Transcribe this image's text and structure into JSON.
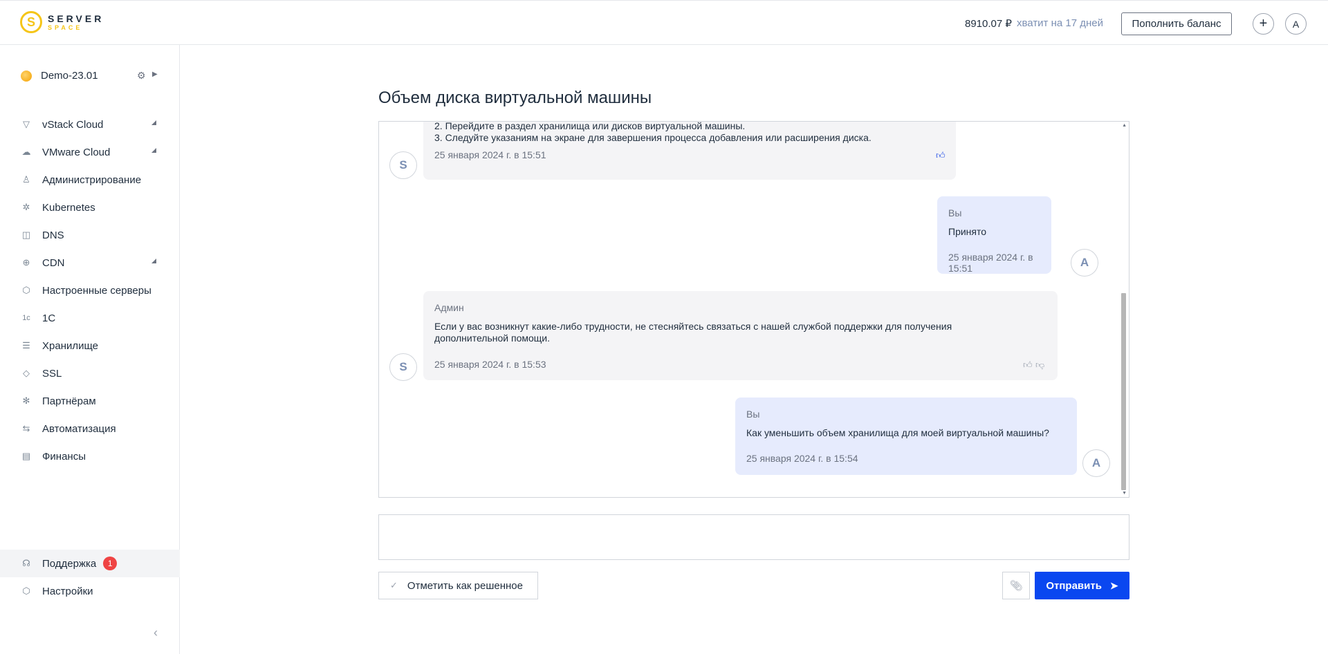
{
  "header": {
    "logo_top": "SERVER",
    "logo_bottom": "SPACE",
    "logo_mark": "S",
    "balance": "8910.07 ₽",
    "enough": "хватит на 17 дней",
    "topup_label": "Пополнить баланс",
    "plus_symbol": "+",
    "user_initial": "A"
  },
  "sidebar": {
    "project_name": "Demo-23.01",
    "items": [
      {
        "label": "vStack Cloud",
        "icon": "▽",
        "caret": true
      },
      {
        "label": "VMware Cloud",
        "icon": "☁",
        "caret": true
      },
      {
        "label": "Администрирование",
        "icon": "♙",
        "caret": false
      },
      {
        "label": "Kubernetes",
        "icon": "✲",
        "caret": false
      },
      {
        "label": "DNS",
        "icon": "◫",
        "caret": false
      },
      {
        "label": "CDN",
        "icon": "⊕",
        "caret": true
      },
      {
        "label": "Настроенные серверы",
        "icon": "⬡",
        "caret": false
      },
      {
        "label": "1С",
        "icon": "1c",
        "caret": false
      },
      {
        "label": "Хранилище",
        "icon": "☰",
        "caret": false
      },
      {
        "label": "SSL",
        "icon": "◇",
        "caret": false
      },
      {
        "label": "Партнёрам",
        "icon": "✻",
        "caret": false
      },
      {
        "label": "Автоматизация",
        "icon": "⇆",
        "caret": false
      },
      {
        "label": "Финансы",
        "icon": "▤",
        "caret": false
      }
    ],
    "support_label": "Поддержка",
    "support_badge": "1",
    "settings_label": "Настройки",
    "collapse_symbol": "‹"
  },
  "main": {
    "title": "Объем диска виртуальной машины",
    "messages": {
      "m1": {
        "line2": "2. Перейдите в раздел хранилища или дисков виртуальной машины.",
        "line3": "3. Следуйте указаниям на экране для завершения процесса добавления или расширения диска.",
        "time": "25 января 2024 г. в 15:51",
        "avatar": "S"
      },
      "m2": {
        "author": "Вы",
        "text": "Принято",
        "time": "25 января 2024 г. в 15:51",
        "avatar": "A"
      },
      "m3": {
        "author": "Админ",
        "text": "Если у вас возникнут какие-либо трудности, не стесняйтесь связаться с нашей службой поддержки для получения дополнительной помощи.",
        "time": "25 января 2024 г. в 15:53",
        "avatar": "S"
      },
      "m4": {
        "author": "Вы",
        "text": "Как уменьшить объем хранилища для моей виртуальной машины?",
        "time": "25 января 2024 г. в 15:54",
        "avatar": "A"
      }
    },
    "resolve_label": "Отметить как решенное",
    "send_label": "Отправить"
  }
}
